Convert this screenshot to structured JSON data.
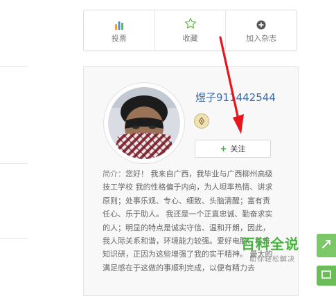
{
  "actions": [
    {
      "label": "投票",
      "icon": "bar-chart-icon"
    },
    {
      "label": "收藏",
      "icon": "star-outline-icon"
    },
    {
      "label": "加入杂志",
      "icon": "plus-circle-icon"
    }
  ],
  "author": {
    "name": "煜子911442544",
    "badge_icon": "pen-nib-icon",
    "follow_label": "关注"
  },
  "bio": {
    "label": "简介：",
    "text": "您好！ 我来自广西，我毕业与广西柳州高级技工学校 我的性格偏于内向，为人坦率热情、讲求原则；处事乐观、专心、细致、头脑清醒；富有责任心、乐于助人。 我还是一个正直忠诚、勤奋求实的人；明显的特点是诚实守信、温和开朗，因此，我人际关系和谐，环境能力较强。爱好电脑、科普知识研，正因为这些增强了我的实干精神。 最大的满足感在于这做的事顺利完成，以便有精力去"
  },
  "watermark": {
    "title": "百科全说",
    "subtitle": "助你轻松解决"
  },
  "colors": {
    "link_blue": "#3b6aa8",
    "brand_green": "#45b43b",
    "arrow_red": "#e8161c"
  }
}
